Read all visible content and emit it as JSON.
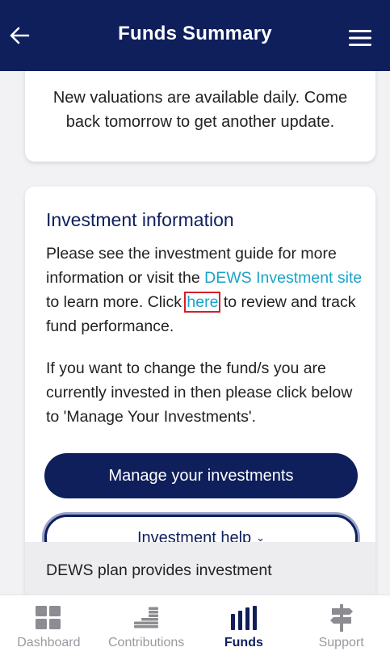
{
  "header": {
    "title": "Funds Summary",
    "back_icon": "arrow-left-icon",
    "menu_icon": "hamburger-menu-icon",
    "background": "#0f1f5c"
  },
  "valuation_card": {
    "message": "New valuations are available daily. Come back tomorrow to get another update."
  },
  "investment_card": {
    "heading": "Investment information",
    "para1_a": "Please see the investment guide for more information or visit the ",
    "para1_link": "DEWS Investment site",
    "para1_b": " to learn more. Click ",
    "para1_here": "here",
    "para1_c": " to review and track fund performance.",
    "para2": "If you want to change the fund/s you are currently invested in then please click below to 'Manage Your Investments'.",
    "manage_button": "Manage your investments",
    "help_button": "Investment help",
    "link_color": "#19a3c8"
  },
  "lower_section": {
    "peek_text": "DEWS plan provides investment"
  },
  "tabbar": {
    "tabs": [
      {
        "label": "Dashboard",
        "icon": "dashboard-grid-icon",
        "active": false
      },
      {
        "label": "Contributions",
        "icon": "coins-stack-icon",
        "active": false
      },
      {
        "label": "Funds",
        "icon": "bar-chart-icon",
        "active": true
      },
      {
        "label": "Support",
        "icon": "signpost-icon",
        "active": false
      }
    ]
  }
}
